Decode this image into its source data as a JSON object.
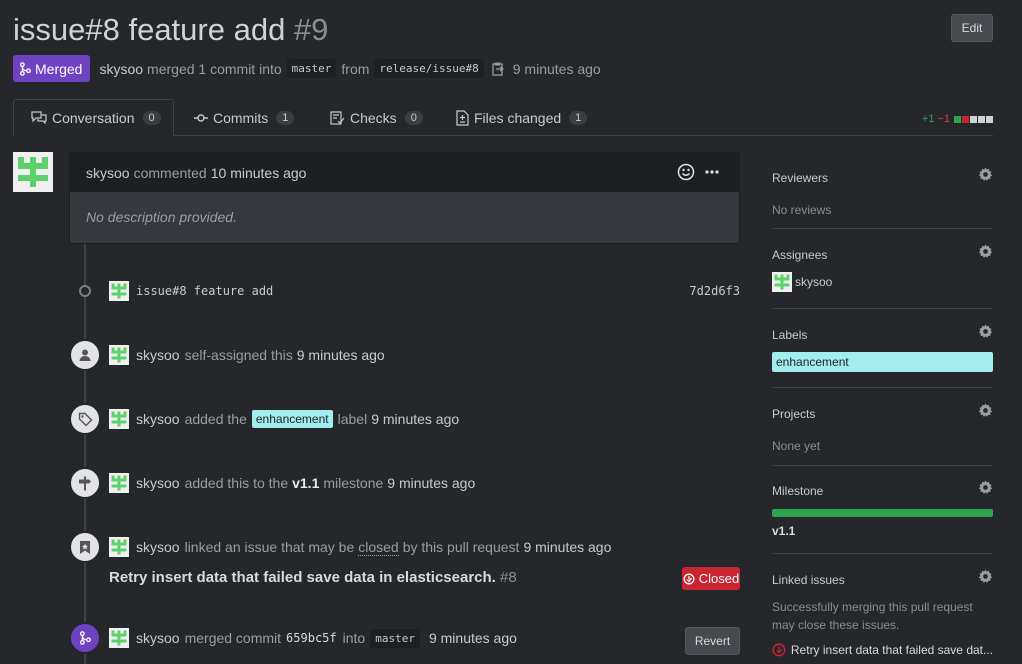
{
  "title": "issue#8 feature add",
  "number": "#9",
  "edit_label": "Edit",
  "meta": {
    "status": "Merged",
    "author": "skysoo",
    "action": "merged 1 commit into",
    "base": "master",
    "from": "from",
    "head": "release/issue#8",
    "time": "9 minutes ago"
  },
  "tabs": [
    {
      "label": "Conversation",
      "count": "0"
    },
    {
      "label": "Commits",
      "count": "1"
    },
    {
      "label": "Checks",
      "count": "0"
    },
    {
      "label": "Files changed",
      "count": "1"
    }
  ],
  "diffstat": {
    "added": "+1",
    "removed": "−1"
  },
  "comment": {
    "author": "skysoo",
    "action": "commented",
    "time": "10 minutes ago",
    "body": "No description provided."
  },
  "commit": {
    "message": "issue#8 feature add",
    "sha": "7d2d6f3"
  },
  "events": {
    "assign": {
      "user": "skysoo",
      "text": "self-assigned this",
      "time": "9 minutes ago"
    },
    "label": {
      "user": "skysoo",
      "pre": "added the",
      "label": "enhancement",
      "post": "label",
      "time": "9 minutes ago"
    },
    "milestone": {
      "user": "skysoo",
      "pre": "added this to the",
      "name": "v1.1",
      "post": "milestone",
      "time": "9 minutes ago"
    },
    "link": {
      "user": "skysoo",
      "pre": "linked an issue that may be",
      "closed": "closed",
      "post": "by this pull request",
      "time": "9 minutes ago"
    },
    "linked_issue": {
      "title": "Retry insert data that failed save data in elasticsearch.",
      "number": "#8",
      "state": "Closed"
    },
    "merge": {
      "user": "skysoo",
      "pre": "merged commit",
      "sha": "659bc5f",
      "into": "into",
      "branch": "master",
      "time": "9 minutes ago",
      "revert": "Revert"
    }
  },
  "sidebar": {
    "reviewers": {
      "title": "Reviewers",
      "value": "No reviews"
    },
    "assignees": {
      "title": "Assignees",
      "value": "skysoo"
    },
    "labels": {
      "title": "Labels",
      "value": "enhancement"
    },
    "projects": {
      "title": "Projects",
      "value": "None yet"
    },
    "milestone": {
      "title": "Milestone",
      "value": "v1.1",
      "progress": 1.0
    },
    "linked": {
      "title": "Linked issues",
      "desc": "Successfully merging this pull request may close these issues.",
      "issue": "Retry insert data that failed save dat..."
    }
  },
  "colors": {
    "accent_merged": "#6f42c1",
    "closed": "#cb2431",
    "label": "#a2eeef",
    "progress": "#2ea44f"
  }
}
